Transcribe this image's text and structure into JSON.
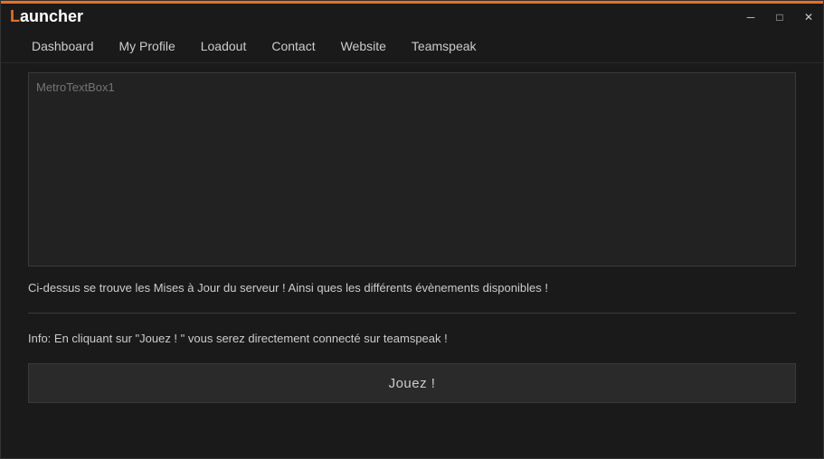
{
  "titleBar": {
    "title_prefix": "L",
    "title_suffix": "auncher",
    "minimize_label": "─",
    "maximize_label": "□",
    "close_label": "✕"
  },
  "nav": {
    "items": [
      {
        "label": "Dashboard",
        "name": "dashboard"
      },
      {
        "label": "My Profile",
        "name": "my-profile"
      },
      {
        "label": "Loadout",
        "name": "loadout"
      },
      {
        "label": "Contact",
        "name": "contact"
      },
      {
        "label": "Website",
        "name": "website"
      },
      {
        "label": "Teamspeak",
        "name": "teamspeak"
      }
    ]
  },
  "main": {
    "textbox_placeholder": "MetroTextBox1",
    "info_text": "Ci-dessus se trouve les Mises à Jour du serveur ! Ainsi ques les différents évènements disponibles !",
    "info_text_2": "Info: En cliquant sur \"Jouez ! \" vous serez directement connecté sur teamspeak !",
    "play_button_label": "Jouez !"
  }
}
